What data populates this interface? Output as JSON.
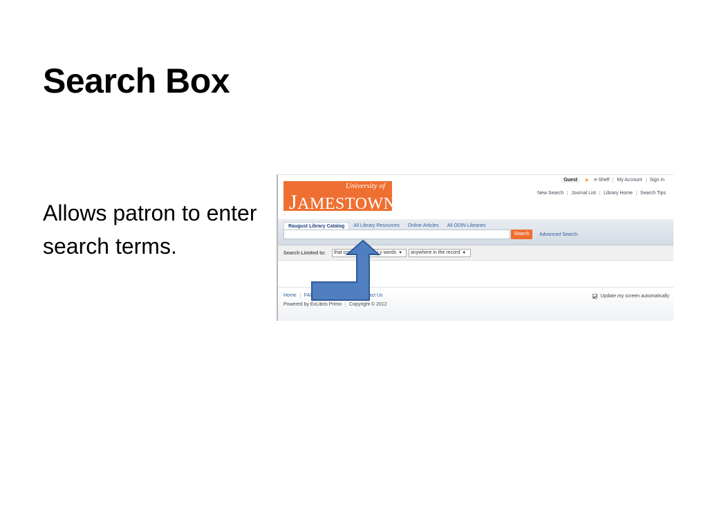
{
  "slide": {
    "title": "Search Box",
    "body": "Allows patron to enter search terms."
  },
  "screenshot": {
    "top_bar": {
      "guest": "Guest",
      "eshelf": "e-Shelf",
      "my_account": "My Account",
      "sign_in": "Sign in"
    },
    "nav_links": [
      "New Search",
      "Journal List",
      "Library Home",
      "Search Tips"
    ],
    "logo": {
      "university_of": "University of",
      "jamestown_initial": "J",
      "jamestown_rest": "AMESTOWN"
    },
    "dash": "-",
    "tabs": [
      "Raugust Library Catalog",
      "All Library Resources",
      "Online Articles",
      "All ODIN Libraries"
    ],
    "search": {
      "value": "",
      "button": "Search",
      "advanced": "Advanced Search"
    },
    "limit": {
      "label": "Search Limited to:",
      "option1": "that cont",
      "option2": "y words",
      "option3": "anywhere in the record"
    },
    "footer": {
      "links": [
        "Home",
        "FAQ",
        "act Us"
      ],
      "powered": "Powered by ExLibris Primo",
      "copyright": "Copyright © 2012",
      "update": "Update my screen automatically"
    },
    "colors": {
      "brand_orange": "#ee6f31",
      "arrow_fill": "#4f7fc1",
      "arrow_stroke": "#2f5a98",
      "link_blue": "#335fa0"
    }
  }
}
